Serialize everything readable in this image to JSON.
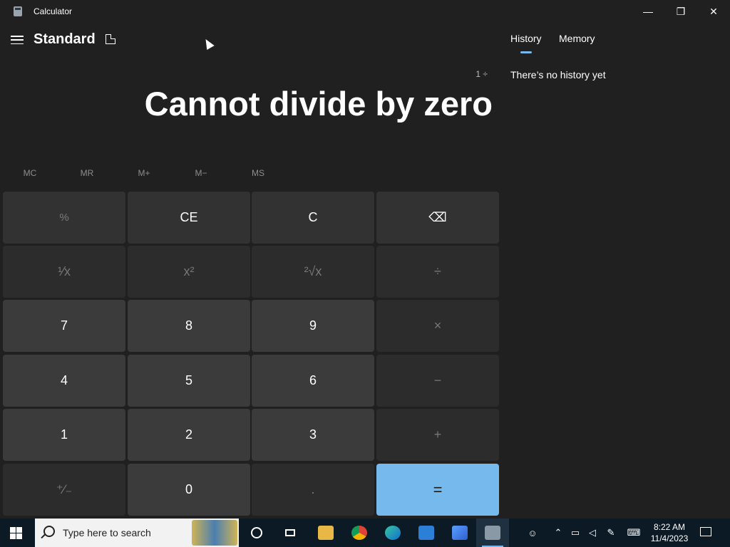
{
  "window": {
    "title": "Calculator",
    "minimize": "—",
    "maximize": "❐",
    "close": "✕"
  },
  "header": {
    "mode": "Standard"
  },
  "display": {
    "expression": "1 ÷",
    "value": "Cannot divide by zero"
  },
  "memory": [
    "MC",
    "MR",
    "M+",
    "M−",
    "MS"
  ],
  "keys": {
    "percent": "%",
    "ce": "CE",
    "clear": "C",
    "backspace": "⌫",
    "reciprocal": "¹⁄x",
    "square": "x²",
    "sqrt": "²√x",
    "divide": "÷",
    "seven": "7",
    "eight": "8",
    "nine": "9",
    "multiply": "×",
    "four": "4",
    "five": "5",
    "six": "6",
    "minus": "−",
    "one": "1",
    "two": "2",
    "three": "3",
    "plus": "+",
    "negate": "⁺∕₋",
    "zero": "0",
    "decimal": ".",
    "equals": "="
  },
  "side": {
    "history_tab": "History",
    "memory_tab": "Memory",
    "empty": "There’s no history yet"
  },
  "taskbar": {
    "search_placeholder": "Type here to search",
    "time": "8:22 AM",
    "date": "11/4/2023",
    "apps": [
      "file-explorer",
      "chrome",
      "edge",
      "store",
      "paint",
      "calculator"
    ]
  },
  "colors": {
    "accent": "#76b9ed",
    "background": "#202020",
    "taskbar": "#0b1a24"
  }
}
